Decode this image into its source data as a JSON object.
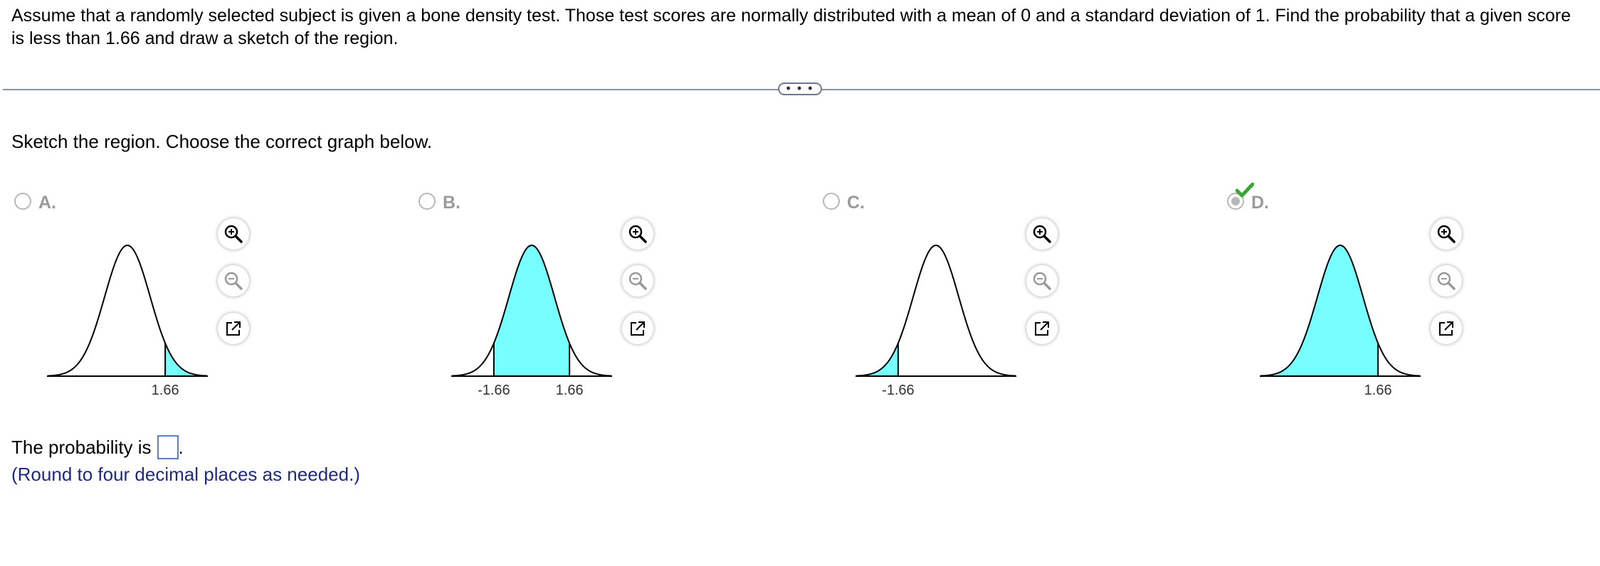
{
  "question": {
    "text": "Assume that a randomly selected subject is given a bone density test. Those test scores are normally distributed with a mean of 0 and a standard deviation of 1. Find the probability that a given score is less than 1.66 and draw a sketch of the region."
  },
  "expander": {
    "label": "• • •"
  },
  "instruction": "Sketch the region. Choose the correct graph below.",
  "options": [
    {
      "letter": "A.",
      "selected": false,
      "shading": "right-tail",
      "labels": [
        "1.66"
      ]
    },
    {
      "letter": "B.",
      "selected": false,
      "shading": "between",
      "labels": [
        "-1.66",
        "1.66"
      ]
    },
    {
      "letter": "C.",
      "selected": false,
      "shading": "left-tail",
      "labels": [
        "-1.66"
      ]
    },
    {
      "letter": "D.",
      "selected": true,
      "shading": "left-of",
      "labels": [
        "1.66"
      ]
    }
  ],
  "icons": {
    "zoom_in": "zoom-in-icon",
    "zoom_out": "zoom-out-icon",
    "popout": "popout-icon",
    "check": "checkmark-icon"
  },
  "colors": {
    "shade": "#77ffff",
    "curve": "#000000",
    "check": "#3aa63a",
    "note": "#1f2a80"
  },
  "answer": {
    "prefix": "The probability is",
    "suffix": ".",
    "value": ""
  },
  "note": "(Round to four decimal places as needed.)"
}
